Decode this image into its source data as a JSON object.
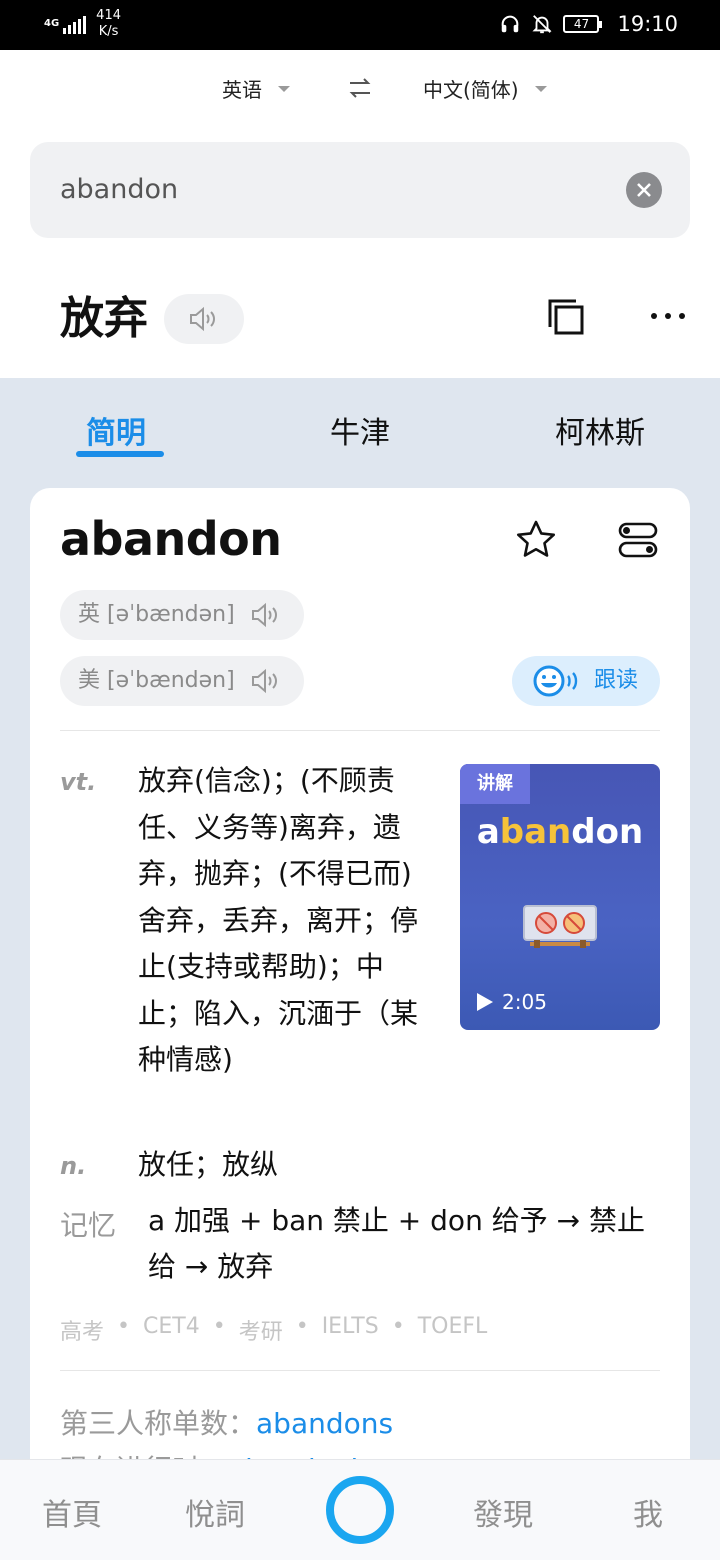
{
  "status_bar": {
    "network": "4G",
    "speed_value": "414",
    "speed_unit": "K/s",
    "battery": "47",
    "time": "19:10"
  },
  "lang_bar": {
    "source_lang": "英语",
    "target_lang": "中文(简体)"
  },
  "search": {
    "query": "abandon"
  },
  "translation": {
    "word": "放弃"
  },
  "tabs": [
    {
      "label": "简明",
      "active": true
    },
    {
      "label": "牛津",
      "active": false
    },
    {
      "label": "柯林斯",
      "active": false
    }
  ],
  "entry": {
    "headword": "abandon",
    "pron_uk": "英 [əˈbændən]",
    "pron_us": "美 [əˈbændən]",
    "follow_read_label": "跟读",
    "senses": [
      {
        "pos": "vt.",
        "def": "放弃(信念)；(不顾责任、义务等)离弃，遗弃，抛弃；(不得已而)舍弃，丢弃，离开；停止(支持或帮助)；中止；陷入，沉湎于（某种情感)"
      },
      {
        "pos": "n.",
        "def": "放任；放纵"
      }
    ],
    "video": {
      "badge": "讲解",
      "title_a": "a",
      "title_ban": "ban",
      "title_don": "don",
      "duration": "2:05"
    },
    "memo_label": "记忆",
    "memo_text": "a 加强 + ban 禁止 + don 给予 → 禁止给 → 放弃",
    "tags": [
      "高考",
      "CET4",
      "考研",
      "IELTS",
      "TOEFL"
    ],
    "tag_separator": "•",
    "forms": [
      {
        "label": "第三人称单数：",
        "value": "abandons"
      },
      {
        "label": "现在进行时：",
        "value": "abandoning"
      }
    ]
  },
  "bottom_nav": {
    "items": [
      "首頁",
      "悅詞",
      "發現",
      "我"
    ]
  },
  "colors": {
    "accent": "#1b8de8",
    "page_bg": "#dfe6ef",
    "nav_center": "#1aa6f0"
  }
}
